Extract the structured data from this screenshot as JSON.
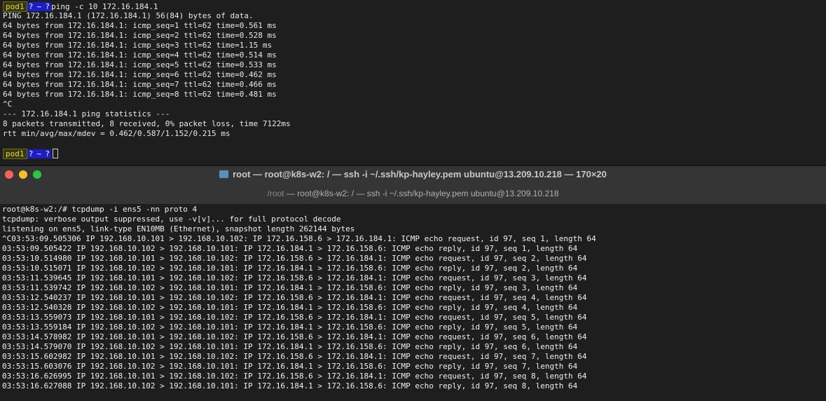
{
  "top_terminal": {
    "prompt": {
      "host": "pod1",
      "q": "?",
      "dir": "~"
    },
    "command": "ping -c 10 172.16.184.1",
    "output": [
      "PING 172.16.184.1 (172.16.184.1) 56(84) bytes of data.",
      "64 bytes from 172.16.184.1: icmp_seq=1 ttl=62 time=0.561 ms",
      "64 bytes from 172.16.184.1: icmp_seq=2 ttl=62 time=0.528 ms",
      "64 bytes from 172.16.184.1: icmp_seq=3 ttl=62 time=1.15 ms",
      "64 bytes from 172.16.184.1: icmp_seq=4 ttl=62 time=0.514 ms",
      "64 bytes from 172.16.184.1: icmp_seq=5 ttl=62 time=0.533 ms",
      "64 bytes from 172.16.184.1: icmp_seq=6 ttl=62 time=0.462 ms",
      "64 bytes from 172.16.184.1: icmp_seq=7 ttl=62 time=0.466 ms",
      "64 bytes from 172.16.184.1: icmp_seq=8 ttl=62 time=0.481 ms",
      "^C",
      "--- 172.16.184.1 ping statistics ---",
      "8 packets transmitted, 8 received, 0% packet loss, time 7122ms",
      "rtt min/avg/max/mdev = 0.462/0.587/1.152/0.215 ms"
    ]
  },
  "window": {
    "title": "root — root@k8s-w2: / — ssh -i ~/.ssh/kp-hayley.pem ubuntu@13.209.10.218 — 170×20",
    "tab_prefix": "/root",
    "tab_title": " — root@k8s-w2: / — ssh -i ~/.ssh/kp-hayley.pem ubuntu@13.209.10.218",
    "colors": {
      "close": "#fe5f57",
      "minimize": "#febc2e",
      "maximize": "#28c840"
    }
  },
  "bottom_terminal": {
    "lines": [
      "root@k8s-w2:/# tcpdump -i ens5 -nn proto 4",
      "tcpdump: verbose output suppressed, use -v[v]... for full protocol decode",
      "listening on ens5, link-type EN10MB (Ethernet), snapshot length 262144 bytes",
      "^C03:53:09.505306 IP 192.168.10.101 > 192.168.10.102: IP 172.16.158.6 > 172.16.184.1: ICMP echo request, id 97, seq 1, length 64",
      "03:53:09.505422 IP 192.168.10.102 > 192.168.10.101: IP 172.16.184.1 > 172.16.158.6: ICMP echo reply, id 97, seq 1, length 64",
      "03:53:10.514980 IP 192.168.10.101 > 192.168.10.102: IP 172.16.158.6 > 172.16.184.1: ICMP echo request, id 97, seq 2, length 64",
      "03:53:10.515071 IP 192.168.10.102 > 192.168.10.101: IP 172.16.184.1 > 172.16.158.6: ICMP echo reply, id 97, seq 2, length 64",
      "03:53:11.539645 IP 192.168.10.101 > 192.168.10.102: IP 172.16.158.6 > 172.16.184.1: ICMP echo request, id 97, seq 3, length 64",
      "03:53:11.539742 IP 192.168.10.102 > 192.168.10.101: IP 172.16.184.1 > 172.16.158.6: ICMP echo reply, id 97, seq 3, length 64",
      "03:53:12.540237 IP 192.168.10.101 > 192.168.10.102: IP 172.16.158.6 > 172.16.184.1: ICMP echo request, id 97, seq 4, length 64",
      "03:53:12.540328 IP 192.168.10.102 > 192.168.10.101: IP 172.16.184.1 > 172.16.158.6: ICMP echo reply, id 97, seq 4, length 64",
      "03:53:13.559073 IP 192.168.10.101 > 192.168.10.102: IP 172.16.158.6 > 172.16.184.1: ICMP echo request, id 97, seq 5, length 64",
      "03:53:13.559184 IP 192.168.10.102 > 192.168.10.101: IP 172.16.184.1 > 172.16.158.6: ICMP echo reply, id 97, seq 5, length 64",
      "03:53:14.578982 IP 192.168.10.101 > 192.168.10.102: IP 172.16.158.6 > 172.16.184.1: ICMP echo request, id 97, seq 6, length 64",
      "03:53:14.579070 IP 192.168.10.102 > 192.168.10.101: IP 172.16.184.1 > 172.16.158.6: ICMP echo reply, id 97, seq 6, length 64",
      "03:53:15.602982 IP 192.168.10.101 > 192.168.10.102: IP 172.16.158.6 > 172.16.184.1: ICMP echo request, id 97, seq 7, length 64",
      "03:53:15.603076 IP 192.168.10.102 > 192.168.10.101: IP 172.16.184.1 > 172.16.158.6: ICMP echo reply, id 97, seq 7, length 64",
      "03:53:16.626995 IP 192.168.10.101 > 192.168.10.102: IP 172.16.158.6 > 172.16.184.1: ICMP echo request, id 97, seq 8, length 64",
      "03:53:16.627088 IP 192.168.10.102 > 192.168.10.101: IP 172.16.184.1 > 172.16.158.6: ICMP echo reply, id 97, seq 8, length 64"
    ]
  }
}
